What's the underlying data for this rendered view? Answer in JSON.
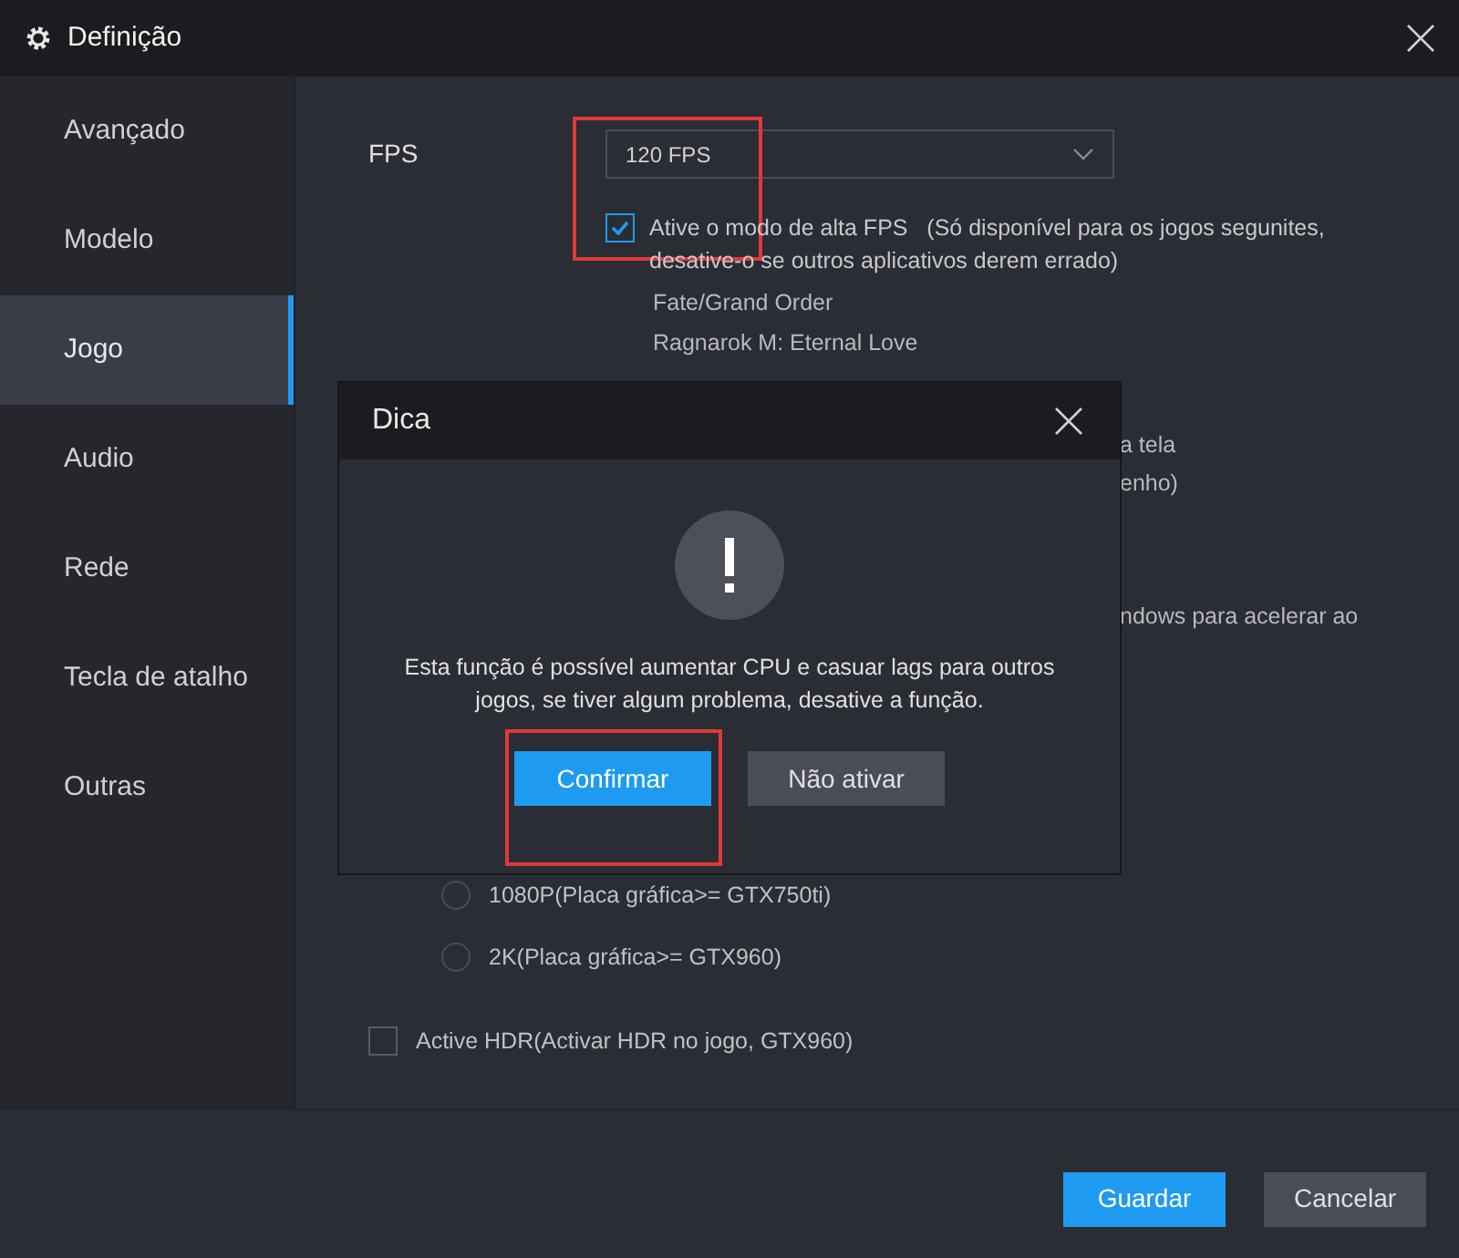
{
  "window": {
    "title": "Definição"
  },
  "sidebar": {
    "items": [
      {
        "label": "Avançado",
        "selected": false
      },
      {
        "label": "Modelo",
        "selected": false
      },
      {
        "label": "Jogo",
        "selected": true
      },
      {
        "label": "Audio",
        "selected": false
      },
      {
        "label": "Rede",
        "selected": false
      },
      {
        "label": "Tecla de atalho",
        "selected": false
      },
      {
        "label": "Outras",
        "selected": false
      }
    ]
  },
  "fps": {
    "label": "FPS",
    "value": "120 FPS",
    "high_fps": {
      "checked": true,
      "text": "Ative o modo de alta FPS   (Só disponível para os jogos segunites, desative-o se outros aplicativos derem errado)"
    },
    "games": [
      "Fate/Grand Order",
      "Ragnarok M: Eternal Love"
    ]
  },
  "partial_texts": [
    "a tela",
    "enho)",
    "ndows para acelerar ao"
  ],
  "resolution_options": [
    {
      "label": "1080P(Placa gráfica>= GTX750ti)",
      "selected": false
    },
    {
      "label": "2K(Placa gráfica>= GTX960)",
      "selected": false
    }
  ],
  "hdr": {
    "checked": false,
    "label": "Active HDR(Activar HDR no jogo, GTX960)"
  },
  "dialog": {
    "title": "Dica",
    "message": "Esta função é possível aumentar CPU e casuar lags para outros jogos, se tiver algum problema, desative a função.",
    "buttons": [
      {
        "label": "Confirmar",
        "kind": "primary"
      },
      {
        "label": "Não ativar",
        "kind": "secondary"
      }
    ]
  },
  "footer": {
    "buttons": [
      {
        "label": "Guardar",
        "kind": "primary"
      },
      {
        "label": "Cancelar",
        "kind": "secondary"
      }
    ]
  }
}
